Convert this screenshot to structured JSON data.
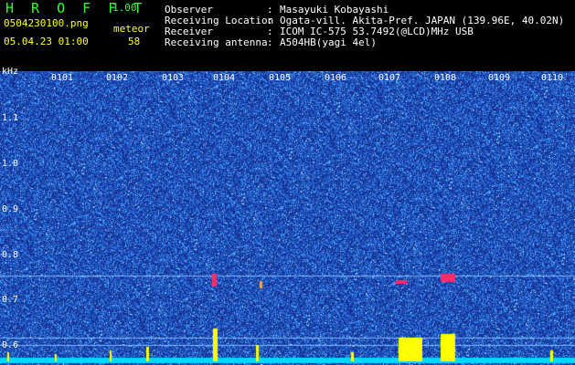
{
  "header": {
    "app_title": "H R O F F T",
    "version": "1.00",
    "filename": "0504230100.png",
    "timestamp": "05.04.23 01:00",
    "type_label": "meteor",
    "count": "58"
  },
  "info": {
    "observer_label": "Observer",
    "observer_value": "Masayuki Kobayashi",
    "location_label": "Receiving Location",
    "location_value": "Ogata-vill. Akita-Pref. JAPAN (139.96E, 40.02N)",
    "receiver_label": "Receiver",
    "receiver_value": "ICOM IC-575 53.7492(@LCD)MHz USB",
    "antenna_label": "Receiving antenna",
    "antenna_value": "A504HB(yagi 4el)",
    "separator": ":"
  },
  "axis": {
    "unit": "kHz",
    "y_ticks": [
      "1.1",
      "1.0",
      "0.9",
      "0.8",
      "0.7",
      "0.6"
    ],
    "x_ticks": [
      "0101",
      "0102",
      "0103",
      "0104",
      "0105",
      "0106",
      "0107",
      "0108",
      "0109",
      "0110"
    ]
  },
  "colors": {
    "background": "#1a3fa0",
    "noise": "#2f7ee0",
    "echo": "#ff2a6a",
    "histogram": "#ffff00",
    "baseline": "#00d8ff",
    "header_green": "#33ff33",
    "header_yellow": "#ffff33"
  }
}
